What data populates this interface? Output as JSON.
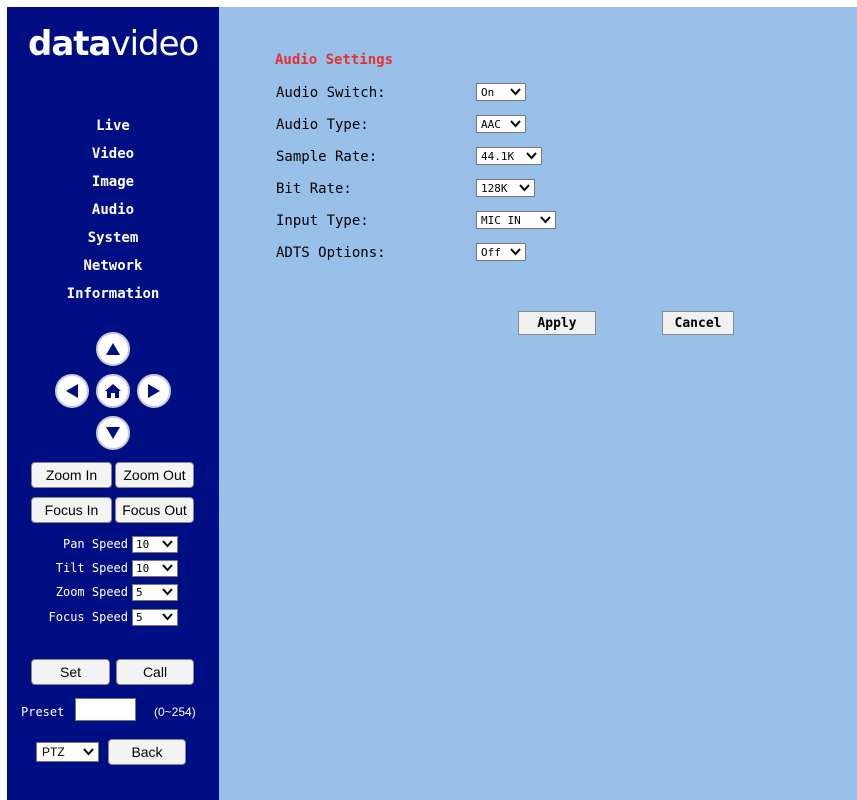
{
  "brand": {
    "logo_part1": "data",
    "logo_part2": "video"
  },
  "nav": [
    "Live",
    "Video",
    "Image",
    "Audio",
    "System",
    "Network",
    "Information"
  ],
  "ptz_buttons": {
    "zoom_in": "Zoom In",
    "zoom_out": "Zoom Out",
    "focus_in": "Focus In",
    "focus_out": "Focus Out"
  },
  "speeds": {
    "pan": {
      "label": "Pan Speed",
      "value": "10"
    },
    "tilt": {
      "label": "Tilt Speed",
      "value": "10"
    },
    "zoom": {
      "label": "Zoom Speed",
      "value": "5"
    },
    "focus": {
      "label": "Focus Speed",
      "value": "5"
    }
  },
  "preset": {
    "set": "Set",
    "call": "Call",
    "label": "Preset",
    "value": "",
    "range": "(0~254)"
  },
  "bottom": {
    "mode": "PTZ",
    "back": "Back"
  },
  "audio": {
    "title": "Audio Settings",
    "rows": [
      {
        "label": "Audio Switch:",
        "value": "On"
      },
      {
        "label": "Audio Type:",
        "value": "AAC"
      },
      {
        "label": "Sample Rate:",
        "value": "44.1K"
      },
      {
        "label": "Bit Rate:",
        "value": "128K"
      },
      {
        "label": "Input Type:",
        "value": "MIC IN"
      },
      {
        "label": "ADTS Options:",
        "value": "Off"
      }
    ],
    "apply": "Apply",
    "cancel": "Cancel"
  },
  "colors": {
    "sidebar": "#000e84",
    "main": "#98c0e8",
    "title": "#e83030"
  }
}
